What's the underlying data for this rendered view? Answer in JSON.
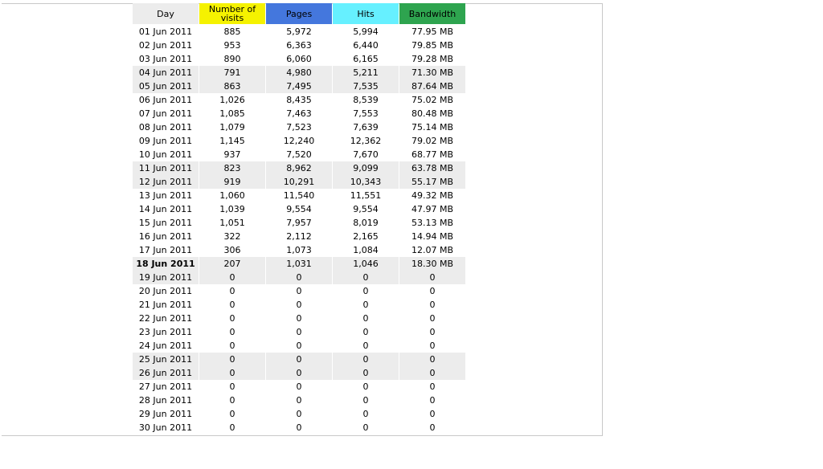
{
  "colors": {
    "day_header": "#ececec",
    "visits_header": "#f5f200",
    "pages_header": "#4477dd",
    "hits_header": "#66f0ff",
    "bandwidth_header": "#2ea44f",
    "row_shade": "#ececec"
  },
  "headers": {
    "day": "Day",
    "visits": "Number of visits",
    "pages": "Pages",
    "hits": "Hits",
    "bandwidth": "Bandwidth"
  },
  "rows": [
    {
      "day": "01 Jun 2011",
      "visits": "885",
      "pages": "5,972",
      "hits": "5,994",
      "bandwidth": "77.95 MB",
      "shaded": false,
      "current": false
    },
    {
      "day": "02 Jun 2011",
      "visits": "953",
      "pages": "6,363",
      "hits": "6,440",
      "bandwidth": "79.85 MB",
      "shaded": false,
      "current": false
    },
    {
      "day": "03 Jun 2011",
      "visits": "890",
      "pages": "6,060",
      "hits": "6,165",
      "bandwidth": "79.28 MB",
      "shaded": false,
      "current": false
    },
    {
      "day": "04 Jun 2011",
      "visits": "791",
      "pages": "4,980",
      "hits": "5,211",
      "bandwidth": "71.30 MB",
      "shaded": true,
      "current": false
    },
    {
      "day": "05 Jun 2011",
      "visits": "863",
      "pages": "7,495",
      "hits": "7,535",
      "bandwidth": "87.64 MB",
      "shaded": true,
      "current": false
    },
    {
      "day": "06 Jun 2011",
      "visits": "1,026",
      "pages": "8,435",
      "hits": "8,539",
      "bandwidth": "75.02 MB",
      "shaded": false,
      "current": false
    },
    {
      "day": "07 Jun 2011",
      "visits": "1,085",
      "pages": "7,463",
      "hits": "7,553",
      "bandwidth": "80.48 MB",
      "shaded": false,
      "current": false
    },
    {
      "day": "08 Jun 2011",
      "visits": "1,079",
      "pages": "7,523",
      "hits": "7,639",
      "bandwidth": "75.14 MB",
      "shaded": false,
      "current": false
    },
    {
      "day": "09 Jun 2011",
      "visits": "1,145",
      "pages": "12,240",
      "hits": "12,362",
      "bandwidth": "79.02 MB",
      "shaded": false,
      "current": false
    },
    {
      "day": "10 Jun 2011",
      "visits": "937",
      "pages": "7,520",
      "hits": "7,670",
      "bandwidth": "68.77 MB",
      "shaded": false,
      "current": false
    },
    {
      "day": "11 Jun 2011",
      "visits": "823",
      "pages": "8,962",
      "hits": "9,099",
      "bandwidth": "63.78 MB",
      "shaded": true,
      "current": false
    },
    {
      "day": "12 Jun 2011",
      "visits": "919",
      "pages": "10,291",
      "hits": "10,343",
      "bandwidth": "55.17 MB",
      "shaded": true,
      "current": false
    },
    {
      "day": "13 Jun 2011",
      "visits": "1,060",
      "pages": "11,540",
      "hits": "11,551",
      "bandwidth": "49.32 MB",
      "shaded": false,
      "current": false
    },
    {
      "day": "14 Jun 2011",
      "visits": "1,039",
      "pages": "9,554",
      "hits": "9,554",
      "bandwidth": "47.97 MB",
      "shaded": false,
      "current": false
    },
    {
      "day": "15 Jun 2011",
      "visits": "1,051",
      "pages": "7,957",
      "hits": "8,019",
      "bandwidth": "53.13 MB",
      "shaded": false,
      "current": false
    },
    {
      "day": "16 Jun 2011",
      "visits": "322",
      "pages": "2,112",
      "hits": "2,165",
      "bandwidth": "14.94 MB",
      "shaded": false,
      "current": false
    },
    {
      "day": "17 Jun 2011",
      "visits": "306",
      "pages": "1,073",
      "hits": "1,084",
      "bandwidth": "12.07 MB",
      "shaded": false,
      "current": false
    },
    {
      "day": "18 Jun 2011",
      "visits": "207",
      "pages": "1,031",
      "hits": "1,046",
      "bandwidth": "18.30 MB",
      "shaded": true,
      "current": true
    },
    {
      "day": "19 Jun 2011",
      "visits": "0",
      "pages": "0",
      "hits": "0",
      "bandwidth": "0",
      "shaded": true,
      "current": false
    },
    {
      "day": "20 Jun 2011",
      "visits": "0",
      "pages": "0",
      "hits": "0",
      "bandwidth": "0",
      "shaded": false,
      "current": false
    },
    {
      "day": "21 Jun 2011",
      "visits": "0",
      "pages": "0",
      "hits": "0",
      "bandwidth": "0",
      "shaded": false,
      "current": false
    },
    {
      "day": "22 Jun 2011",
      "visits": "0",
      "pages": "0",
      "hits": "0",
      "bandwidth": "0",
      "shaded": false,
      "current": false
    },
    {
      "day": "23 Jun 2011",
      "visits": "0",
      "pages": "0",
      "hits": "0",
      "bandwidth": "0",
      "shaded": false,
      "current": false
    },
    {
      "day": "24 Jun 2011",
      "visits": "0",
      "pages": "0",
      "hits": "0",
      "bandwidth": "0",
      "shaded": false,
      "current": false
    },
    {
      "day": "25 Jun 2011",
      "visits": "0",
      "pages": "0",
      "hits": "0",
      "bandwidth": "0",
      "shaded": true,
      "current": false
    },
    {
      "day": "26 Jun 2011",
      "visits": "0",
      "pages": "0",
      "hits": "0",
      "bandwidth": "0",
      "shaded": true,
      "current": false
    },
    {
      "day": "27 Jun 2011",
      "visits": "0",
      "pages": "0",
      "hits": "0",
      "bandwidth": "0",
      "shaded": false,
      "current": false
    },
    {
      "day": "28 Jun 2011",
      "visits": "0",
      "pages": "0",
      "hits": "0",
      "bandwidth": "0",
      "shaded": false,
      "current": false
    },
    {
      "day": "29 Jun 2011",
      "visits": "0",
      "pages": "0",
      "hits": "0",
      "bandwidth": "0",
      "shaded": false,
      "current": false
    },
    {
      "day": "30 Jun 2011",
      "visits": "0",
      "pages": "0",
      "hits": "0",
      "bandwidth": "0",
      "shaded": false,
      "current": false
    }
  ]
}
